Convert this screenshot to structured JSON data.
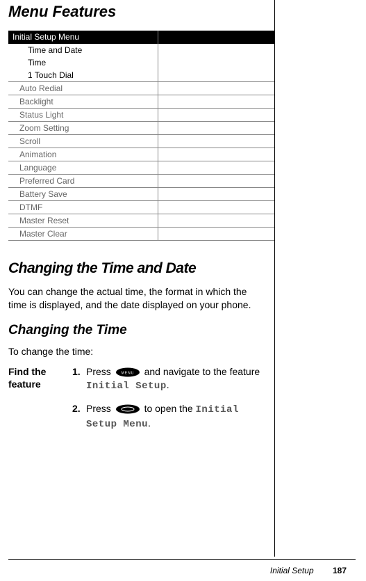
{
  "page_title": "Menu Features",
  "menu": {
    "header": "Initial Setup Menu",
    "sub_items": [
      "Time and Date",
      "Time",
      "1 Touch Dial"
    ],
    "rows": [
      "Auto Redial",
      "Backlight",
      "Status Light",
      "Zoom Setting",
      "Scroll",
      "Animation",
      "Language",
      "Preferred Card",
      "Battery Save",
      "DTMF",
      "Master Reset",
      "Master Clear"
    ]
  },
  "section1": {
    "heading": "Changing the Time and Date",
    "body": "You can change the actual time, the format in which the time is displayed, and the date displayed on your phone."
  },
  "section2": {
    "heading": "Changing the Time",
    "intro": "To change the time:"
  },
  "steps": {
    "label": "Find the feature",
    "s1_num": "1.",
    "s1_a": "Press ",
    "s1_b": " and navigate to the feature ",
    "s1_feat": "Initial Setup",
    "s1_c": ".",
    "s2_num": "2.",
    "s2_a": "Press ",
    "s2_b": " to open the ",
    "s2_feat": "Initial Setup Menu",
    "s2_c": "."
  },
  "icons": {
    "menu_button": "MENU",
    "select_button": "select-key"
  },
  "footer": {
    "section": "Initial Setup",
    "page": "187"
  }
}
